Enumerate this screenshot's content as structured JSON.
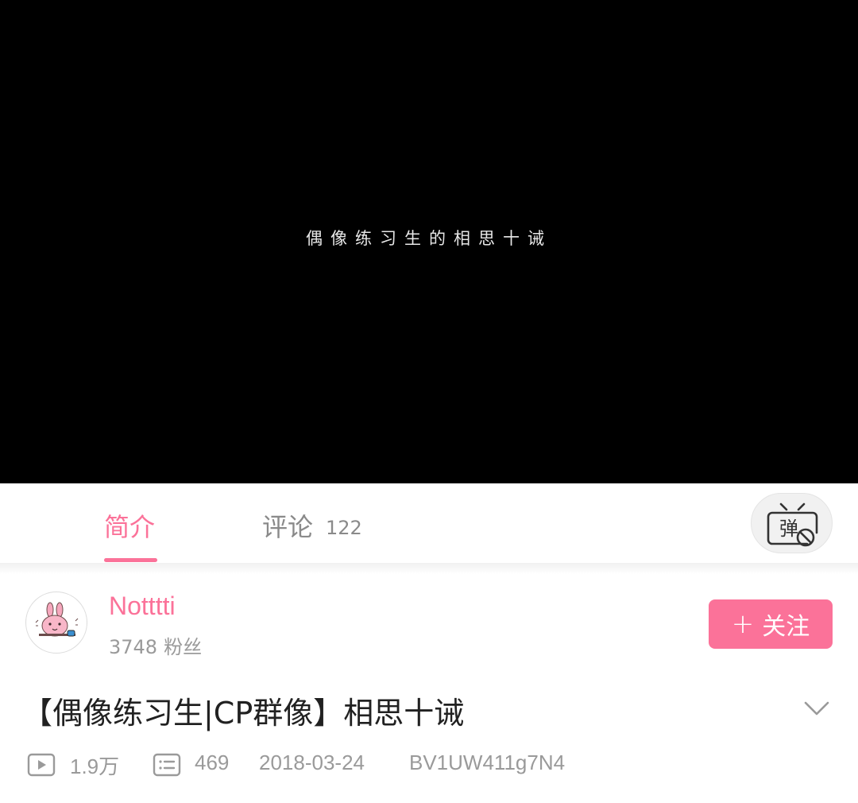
{
  "video": {
    "caption": "偶像练习生的相思十诫"
  },
  "tabs": [
    {
      "label": "简介",
      "active": true
    },
    {
      "label": "评论",
      "count": "122",
      "active": false
    }
  ],
  "danmaku_toggle": {
    "glyph": "弹",
    "icon": "danmaku-off-icon"
  },
  "uploader": {
    "name": "Notttti",
    "fans_count": "3748",
    "fans_label": "粉丝",
    "follow_label": "关注",
    "follow_plus": "+"
  },
  "video_info": {
    "title": "【偶像练习生|CP群像】相思十诫",
    "views": "1.9万",
    "danmaku_count": "469",
    "date": "2018-03-24",
    "bvid": "BV1UW411g7N4"
  },
  "colors": {
    "accent": "#fb7299",
    "text_primary": "#212121",
    "text_secondary": "#9a9a9a",
    "video_bg": "#000000"
  }
}
